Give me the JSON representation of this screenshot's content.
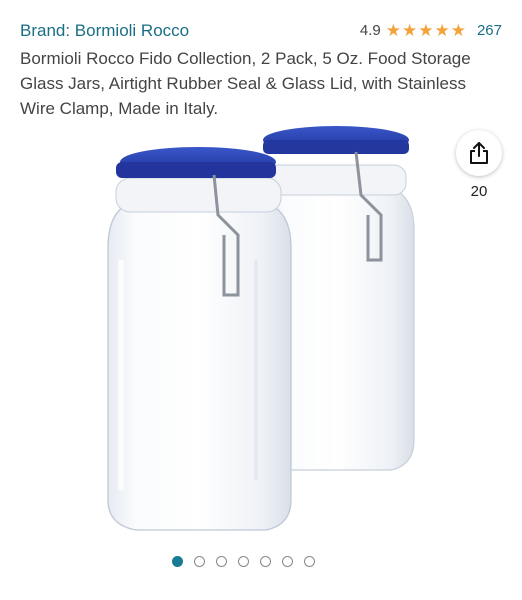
{
  "product": {
    "brand": "Brand: Bormioli Rocco",
    "rating": "4.9",
    "stars_value": 5,
    "review_count": "267",
    "title": "Bormioli Rocco Fido Collection, 2 Pack, 5  Oz. Food Storage Glass Jars, Airtight Rubber Seal & Glass Lid, with Stainless Wire Clamp, Made in Italy."
  },
  "share": {
    "count": "20",
    "icon": "share-icon"
  },
  "gallery": {
    "total": 7,
    "active_index": 0,
    "image": "two-glass-jars-with-blue-lids"
  },
  "colors": {
    "link": "#1a6e86",
    "star": "#f3a33a",
    "dot_active": "#187a94"
  }
}
